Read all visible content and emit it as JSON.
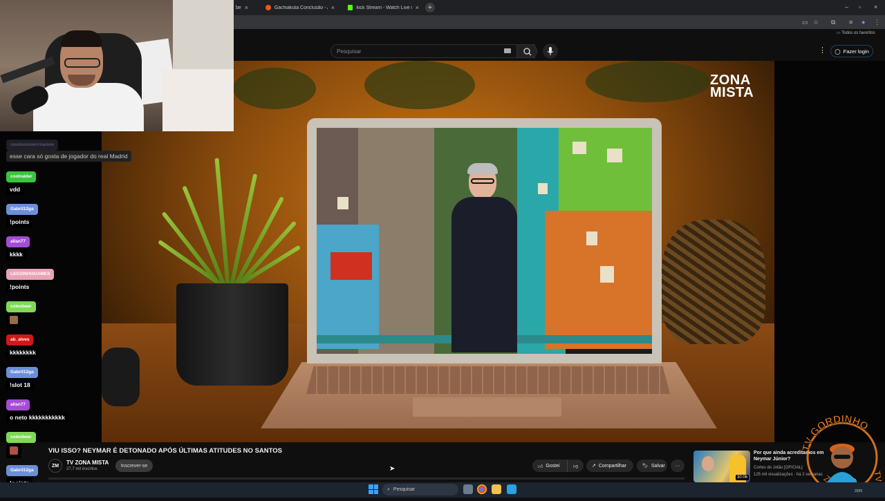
{
  "browser": {
    "tabs": [
      {
        "label": "be"
      },
      {
        "label": "Gachiakuta Conclusão - Assistir"
      },
      {
        "label": "kick Stream - Watch Live on Ki"
      }
    ],
    "new_tab": "+",
    "bookmarks_label": "Todos os favoritos"
  },
  "header": {
    "search_placeholder": "Pesquisar",
    "login_label": "Fazer login"
  },
  "video": {
    "overlay_logo_line1": "ZONA",
    "overlay_logo_line2": "MISTA",
    "title": "VIU ISSO? NEYMAR É DETONADO APÓS ÚLTIMAS ATITUDES NO SANTOS",
    "channel_avatar": "ZM",
    "channel_name": "TV ZONA MISTA",
    "subscribers": "27,7 mil inscritos",
    "subscribe_label": "Inscrever-se",
    "like_label": "Gostei",
    "share_label": "Compartilhar",
    "save_label": "Salvar",
    "more_label": "···"
  },
  "chat": [
    {
      "user": "randomuserrrnamee",
      "text": "esse cara só gosta de jogador do real Madrid",
      "color": "#1f1f2a"
    },
    {
      "user": "coolraider",
      "text": "vdd",
      "color": "#3cc43c"
    },
    {
      "user": "Gabril12ga",
      "text": "!points",
      "color": "#6d8fd8"
    },
    {
      "user": "allan77",
      "text": "kkkk",
      "color": "#a54cd6"
    },
    {
      "user": "LEOZINHOGAMES",
      "text": "!points",
      "color": "#e8a3b6"
    },
    {
      "user": "coleobeer",
      "text": "",
      "color": "#7ed957"
    },
    {
      "user": "ab_alves",
      "text": "kkkkkkkk",
      "color": "#d01818"
    },
    {
      "user": "Gabril12ga",
      "text": "!slot 18",
      "color": "#6d8fd8"
    },
    {
      "user": "allan77",
      "text": "o neto kkkkkkkkkkk",
      "color": "#a54cd6"
    },
    {
      "user": "coleobeer",
      "text": "",
      "color": "#7ed957"
    },
    {
      "user": "Gabril12ga",
      "text": "!points",
      "color": "#6d8fd8"
    }
  ],
  "recommended": {
    "title": "Por que ainda acreditamos em Neymar Júnior?",
    "channel": "Cortes do Jotão [OFICIAL]",
    "views": "125 mil visualizações · há 2 semanas",
    "duration": "30:06"
  },
  "brand": {
    "text_top": "TV GORDINHO",
    "text_side": "TV",
    "text_bottom": "ZÓINHO"
  },
  "taskbar": {
    "search_placeholder": "Pesquisar",
    "tray_date": "2025"
  },
  "colors": {
    "accent": "#3ea6ff",
    "brand_orange": "#ff8a1e"
  }
}
